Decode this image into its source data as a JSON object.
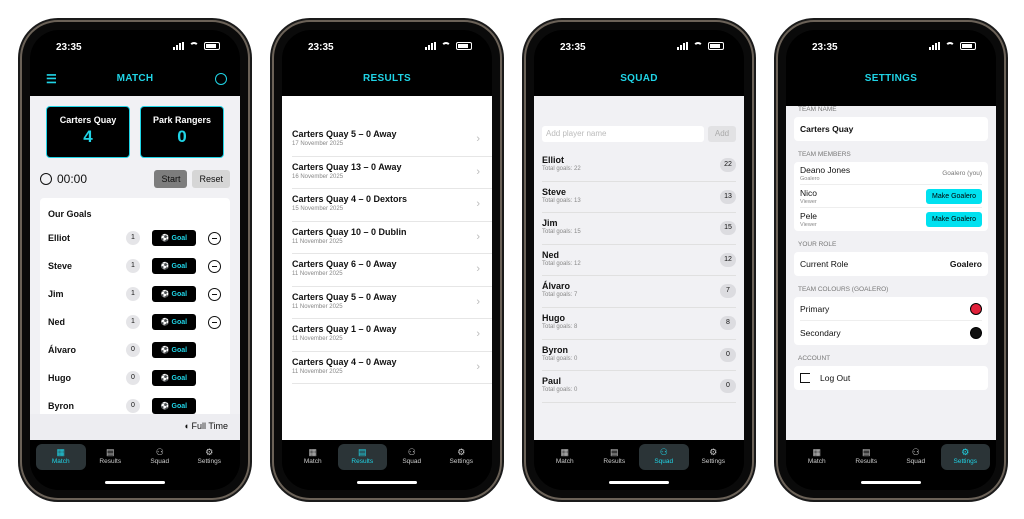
{
  "status": {
    "time": "23:35"
  },
  "tabs": [
    "Match",
    "Results",
    "Squad",
    "Settings"
  ],
  "match": {
    "title": "MATCH",
    "home_team": "Carters Quay",
    "home_score": "4",
    "away_team": "Park Rangers",
    "away_score": "0",
    "timer": "00:00",
    "start_label": "Start",
    "reset_label": "Reset",
    "goals_title": "Our Goals",
    "goal_label": "Goal",
    "players": [
      {
        "name": "Elliot",
        "count": "1",
        "minus": true
      },
      {
        "name": "Steve",
        "count": "1",
        "minus": true
      },
      {
        "name": "Jim",
        "count": "1",
        "minus": true
      },
      {
        "name": "Ned",
        "count": "1",
        "minus": true
      },
      {
        "name": "Álvaro",
        "count": "0",
        "minus": false
      },
      {
        "name": "Hugo",
        "count": "0",
        "minus": false
      },
      {
        "name": "Byron",
        "count": "0",
        "minus": false
      }
    ],
    "full_time_label": "Full Time"
  },
  "results": {
    "title": "RESULTS",
    "items": [
      {
        "title": "Carters Quay 5 – 0 Away",
        "date": "17 November 2025"
      },
      {
        "title": "Carters Quay 13 – 0 Away",
        "date": "16 November 2025"
      },
      {
        "title": "Carters Quay 4 – 0 Dextors",
        "date": "15 November 2025"
      },
      {
        "title": "Carters Quay 10 – 0 Dublin",
        "date": "11 November 2025"
      },
      {
        "title": "Carters Quay 6 – 0 Away",
        "date": "11 November 2025"
      },
      {
        "title": "Carters Quay 5 – 0 Away",
        "date": "11 November 2025"
      },
      {
        "title": "Carters Quay 1 – 0 Away",
        "date": "11 November 2025"
      },
      {
        "title": "Carters Quay 4 – 0 Away",
        "date": "11 November 2025"
      }
    ]
  },
  "squad": {
    "title": "SQUAD",
    "add_placeholder": "Add player name",
    "add_label": "Add",
    "players": [
      {
        "name": "Elliot",
        "goals": "Total goals: 22",
        "count": "22"
      },
      {
        "name": "Steve",
        "goals": "Total goals: 13",
        "count": "13"
      },
      {
        "name": "Jim",
        "goals": "Total goals: 15",
        "count": "15"
      },
      {
        "name": "Ned",
        "goals": "Total goals: 12",
        "count": "12"
      },
      {
        "name": "Álvaro",
        "goals": "Total goals: 7",
        "count": "7"
      },
      {
        "name": "Hugo",
        "goals": "Total goals: 8",
        "count": "8"
      },
      {
        "name": "Byron",
        "goals": "Total goals: 0",
        "count": "0"
      },
      {
        "name": "Paul",
        "goals": "Total goals: 0",
        "count": "0"
      }
    ]
  },
  "settings": {
    "title": "SETTINGS",
    "team_name_header": "TEAM NAME",
    "team_name": "Carters Quay",
    "members_header": "TEAM MEMBERS",
    "members": [
      {
        "name": "Deano Jones",
        "role": "Goalero",
        "right": "Goalero (you)",
        "button": false
      },
      {
        "name": "Nico",
        "role": "Viewer",
        "right": "Make Goalero",
        "button": true
      },
      {
        "name": "Pele",
        "role": "Viewer",
        "right": "Make Goalero",
        "button": true
      }
    ],
    "role_header": "YOUR ROLE",
    "current_role_label": "Current Role",
    "current_role_value": "Goalero",
    "colours_header": "TEAM COLOURS (GOALERO)",
    "primary_label": "Primary",
    "secondary_label": "Secondary",
    "primary_color": "#e0213a",
    "secondary_color": "#111111",
    "account_header": "ACCOUNT",
    "logout_label": "Log Out"
  },
  "colors": {
    "accent": "#20d4e6"
  }
}
